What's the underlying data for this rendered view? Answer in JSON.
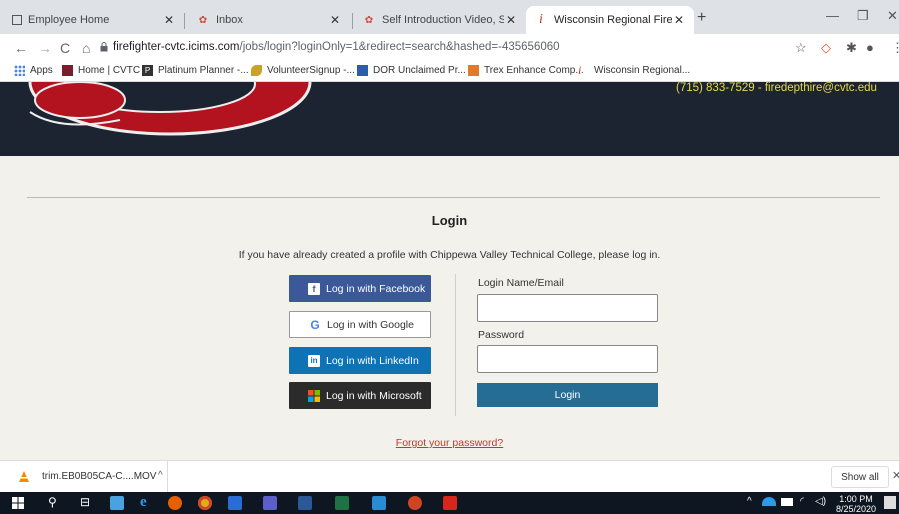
{
  "browser": {
    "tabs": [
      {
        "title": "Employee Home",
        "active": false
      },
      {
        "title": "Inbox",
        "active": false
      },
      {
        "title": "Self Introduction Video, SpeedGr",
        "active": false
      },
      {
        "title": "Wisconsin Regional Fire Departm",
        "active": true
      }
    ],
    "new_tab_icon": "plus-icon",
    "window_controls": {
      "minimize": "—",
      "restore": "❐",
      "close": "✕"
    },
    "url": {
      "host": "firefighter-cvtc.icims.com",
      "path": "/jobs/login?loginOnly=1&redirect=search&hashed=-435656060"
    },
    "bookmarks": [
      {
        "label": "Apps"
      },
      {
        "label": "Home | CVTC"
      },
      {
        "label": "Platinum Planner -..."
      },
      {
        "label": "VolunteerSignup -..."
      },
      {
        "label": "DOR Unclaimed Pr..."
      },
      {
        "label": "Trex Enhance Comp..."
      },
      {
        "label": "Wisconsin Regional..."
      }
    ]
  },
  "page": {
    "contact": "(715) 833-7529 - firedepthire@cvtc.edu",
    "login_title": "Login",
    "intro": "If you have already created a profile with Chippewa Valley Technical College, please log in.",
    "social": {
      "facebook": "Log in with Facebook",
      "google": "Log in with Google",
      "linkedin": "Log in with LinkedIn",
      "microsoft": "Log in with Microsoft"
    },
    "form": {
      "login_label": "Login Name/Email",
      "login_value": "",
      "password_label": "Password",
      "password_value": "",
      "submit": "Login"
    },
    "forgot": "Forgot your password?",
    "colors": {
      "banner": "#1b2430",
      "facebook": "#3b5998",
      "linkedin": "#0f72b5",
      "microsoft": "#2b2b2b",
      "login_button": "#256d95",
      "contact_text": "#e8d84a"
    }
  },
  "downloads": {
    "file_name": "trim.EB0B05CA-C....MOV",
    "show_all": "Show all"
  },
  "taskbar": {
    "time": "1:00 PM",
    "date": "8/25/2020"
  }
}
